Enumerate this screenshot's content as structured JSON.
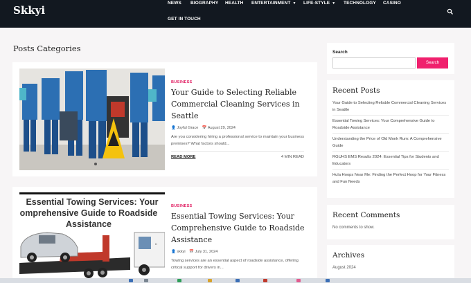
{
  "header": {
    "logo": "Skkyi",
    "nav": [
      {
        "label": "NEWS",
        "dropdown": false
      },
      {
        "label": "BIOGRAPHY",
        "dropdown": false
      },
      {
        "label": "HEALTH",
        "dropdown": false
      },
      {
        "label": "ENTERTAINMENT",
        "dropdown": true
      },
      {
        "label": "LIFE-STYLE",
        "dropdown": true
      },
      {
        "label": "TECHNOLOGY",
        "dropdown": false
      },
      {
        "label": "CASINO",
        "dropdown": false
      },
      {
        "label": "GET IN TOUCH",
        "dropdown": false
      }
    ],
    "search_icon": "search-icon"
  },
  "main": {
    "section_title": "Posts Categories",
    "posts": [
      {
        "category": "BUSINESS",
        "title": "Your Guide to Selecting Reliable Commercial Cleaning Services in Seattle",
        "author": "Joyful Grace",
        "date": "August 29, 2024",
        "excerpt": "Are you considering hiring a professional service to maintain your business premises? What factors should...",
        "read_more": "READ MORE",
        "read_time": "4 MIN READ",
        "image": "cleaning-crew-photo"
      },
      {
        "category": "BUSINESS",
        "title": "Essential Towing Services: Your Comprehensive Guide to Roadside Assistance",
        "author": "skkyi",
        "date": "July 31, 2024",
        "excerpt": "Towing services are an essential aspect of roadside assistance, offering critical support for drivers in...",
        "image": "tow-truck-graphic",
        "image_text": [
          "Essential Towing Services: Your",
          "omprehensive Guide to Roadside",
          "Assistance"
        ]
      }
    ]
  },
  "sidebar": {
    "search": {
      "label": "Search",
      "placeholder": "",
      "button": "Search"
    },
    "recent_posts": {
      "title": "Recent Posts",
      "items": [
        "Your Guide to Selecting Reliable Commercial Cleaning Services in Seattle",
        "Essential Towing Services: Your Comprehensive Guide to Roadside Assistance",
        "Understanding the Price of Old Monk Rum: A Comprehensive Guide",
        "RGUHS EMS Results 2024: Essential Tips for Students and Educators",
        "Hula Hoops Near Me: Finding the Perfect Hoop for Your Fitness and Fun Needs"
      ]
    },
    "recent_comments": {
      "title": "Recent Comments",
      "text": "No comments to show."
    },
    "archives": {
      "title": "Archives",
      "items": [
        "August 2024"
      ]
    }
  },
  "colors": {
    "header_bg": "#121820",
    "accent": "#f0206d",
    "category": "#e0195e"
  }
}
